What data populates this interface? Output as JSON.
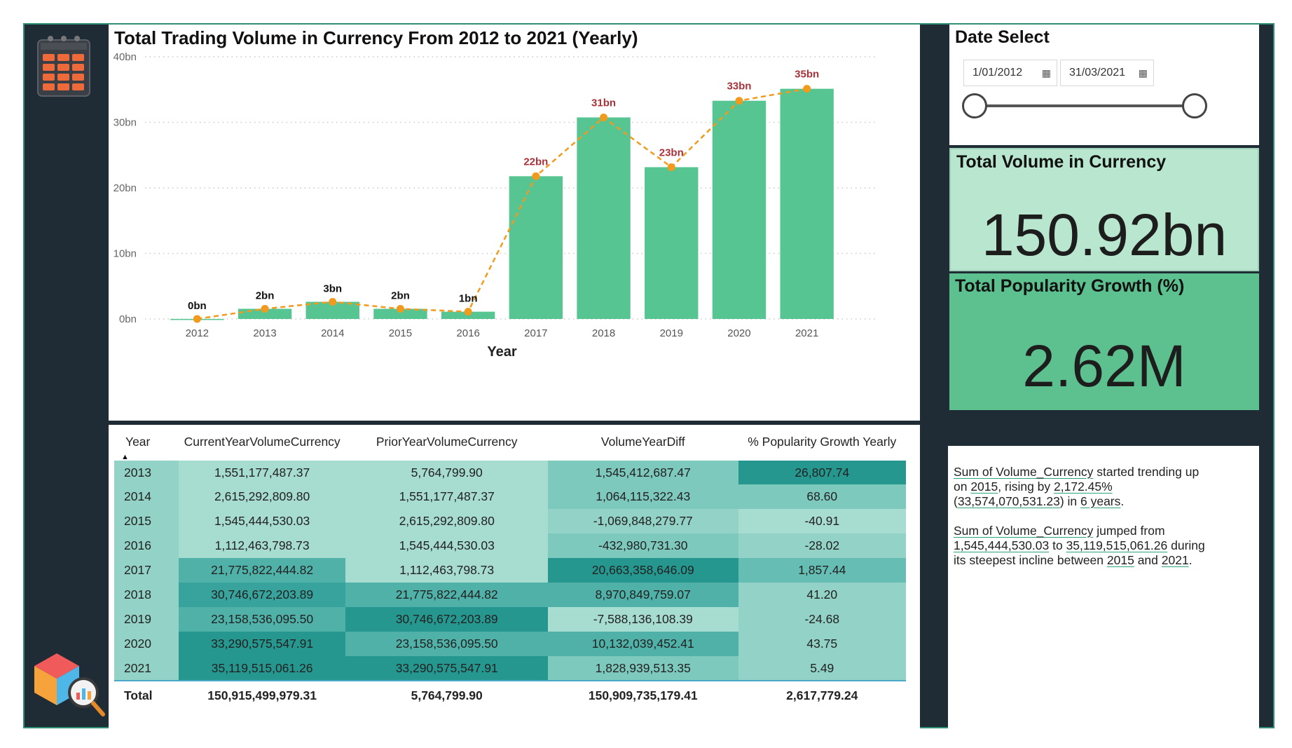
{
  "chart_data": {
    "type": "bar",
    "title": "Total Trading Volume in Currency From 2012 to 2021 (Yearly)",
    "xlabel": "Year",
    "ylabel": "",
    "categories": [
      "2012",
      "2013",
      "2014",
      "2015",
      "2016",
      "2017",
      "2018",
      "2019",
      "2020",
      "2021"
    ],
    "values": [
      0.006,
      1.55,
      2.62,
      1.55,
      1.11,
      21.78,
      30.75,
      23.16,
      33.29,
      35.12
    ],
    "data_labels": [
      "0bn",
      "2bn",
      "3bn",
      "2bn",
      "1bn",
      "22bn",
      "31bn",
      "23bn",
      "33bn",
      "35bn"
    ],
    "ylim": [
      0,
      40
    ],
    "yticks": [
      0,
      10,
      20,
      30,
      40
    ],
    "ytick_labels": [
      "0bn",
      "10bn",
      "20bn",
      "30bn",
      "40bn"
    ],
    "grid": true,
    "overlay_line": {
      "type": "line",
      "style": "dashed",
      "values": [
        0.006,
        1.55,
        2.62,
        1.55,
        1.11,
        21.78,
        30.75,
        23.16,
        33.29,
        35.12
      ]
    },
    "colors": {
      "bar": "#57c592",
      "line": "#f29a1e",
      "label_small": "#111111",
      "label_large": "#a8323a"
    }
  },
  "table": {
    "columns": [
      "Year",
      "CurrentYearVolumeCurrency",
      "PriorYearVolumeCurrency",
      "VolumeYearDiff",
      "% Popularity Growth Yearly"
    ],
    "rows": [
      {
        "year": "2013",
        "current": "1,551,177,487.37",
        "prior": "5,764,799.90",
        "diff": "1,545,412,687.47",
        "growth": "26,807.74"
      },
      {
        "year": "2014",
        "current": "2,615,292,809.80",
        "prior": "1,551,177,487.37",
        "diff": "1,064,115,322.43",
        "growth": "68.60"
      },
      {
        "year": "2015",
        "current": "1,545,444,530.03",
        "prior": "2,615,292,809.80",
        "diff": "-1,069,848,279.77",
        "growth": "-40.91"
      },
      {
        "year": "2016",
        "current": "1,112,463,798.73",
        "prior": "1,545,444,530.03",
        "diff": "-432,980,731.30",
        "growth": "-28.02"
      },
      {
        "year": "2017",
        "current": "21,775,822,444.82",
        "prior": "1,112,463,798.73",
        "diff": "20,663,358,646.09",
        "growth": "1,857.44"
      },
      {
        "year": "2018",
        "current": "30,746,672,203.89",
        "prior": "21,775,822,444.82",
        "diff": "8,970,849,759.07",
        "growth": "41.20"
      },
      {
        "year": "2019",
        "current": "23,158,536,095.50",
        "prior": "30,746,672,203.89",
        "diff": "-7,588,136,108.39",
        "growth": "-24.68"
      },
      {
        "year": "2020",
        "current": "33,290,575,547.91",
        "prior": "23,158,536,095.50",
        "diff": "10,132,039,452.41",
        "growth": "43.75"
      },
      {
        "year": "2021",
        "current": "35,119,515,061.26",
        "prior": "33,290,575,547.91",
        "diff": "1,828,939,513.35",
        "growth": "5.49"
      }
    ],
    "total": {
      "year": "Total",
      "current": "150,915,499,979.31",
      "prior": "5,764,799.90",
      "diff": "150,909,735,179.41",
      "growth": "2,617,779.24"
    }
  },
  "date_select": {
    "title": "Date Select",
    "start": "1/01/2012",
    "end": "31/03/2021"
  },
  "kpi_volume": {
    "title": "Total Volume in Currency",
    "value": "150.92bn"
  },
  "kpi_growth": {
    "title": "Total Popularity Growth (%)",
    "value": "2.62M"
  },
  "narrative": {
    "p1": {
      "s1": "Sum of Volume_Currency",
      "t1": " started trending up on ",
      "s2": "2015",
      "t2": ", rising by ",
      "s3": "2,172.45%",
      "t3": " (",
      "s4": "33,574,070,531.23",
      "t4": ") in ",
      "s5": "6 years",
      "t5": "."
    },
    "p2": {
      "s1": "Sum of Volume_Currency",
      "t1": " jumped from ",
      "s2": "1,545,444,530.03",
      "t2": " to ",
      "s3": "35,119,515,061.26",
      "t3": " during its steepest incline between ",
      "s4": "2015",
      "t4": " and ",
      "s5": "2021",
      "t5": "."
    }
  },
  "icons": {
    "calendar": "calendar-icon",
    "analytics": "analytics-cube-icon",
    "date_picker": "calendar-small-icon"
  }
}
